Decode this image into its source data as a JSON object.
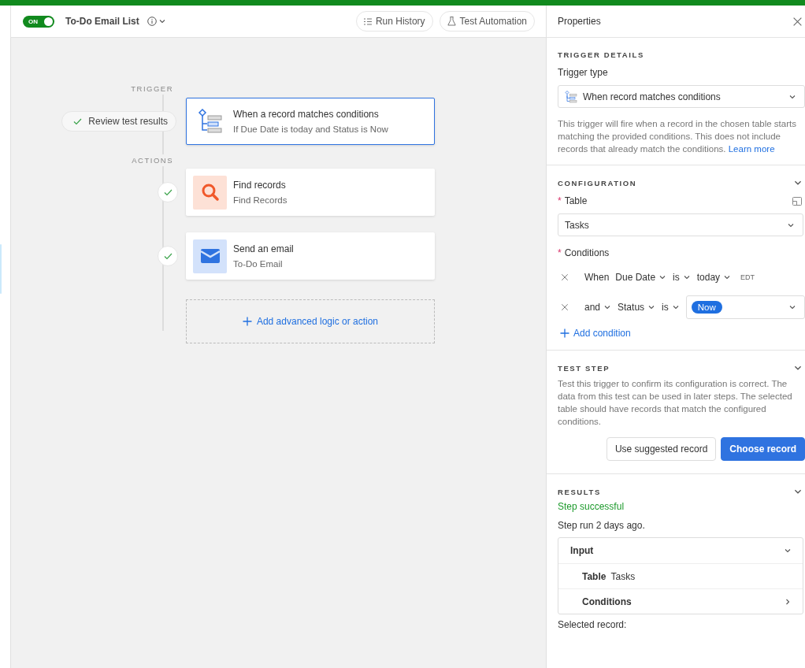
{
  "header": {
    "toggle": {
      "label": "ON",
      "on": true
    },
    "title": "To-Do Email List",
    "buttons": [
      {
        "label": "Run History",
        "kind": "history"
      },
      {
        "label": "Test Automation",
        "kind": "test"
      }
    ]
  },
  "canvas": {
    "trigger_label": "TRIGGER",
    "review_badge": "Review test results",
    "actions_label": "ACTIONS",
    "trigger": {
      "title": "When a record matches conditions",
      "subtitle": "If Due Date is today and Status is Now",
      "selected": true
    },
    "actions": [
      {
        "kind": "find",
        "title": "Find records",
        "subtitle": "Find Records",
        "done": true,
        "selected": false
      },
      {
        "kind": "email",
        "title": "Send an email",
        "subtitle": "To-Do Email",
        "done": true,
        "selected": false
      }
    ],
    "add_button": "Add advanced logic or action"
  },
  "properties": {
    "title": "Properties",
    "trigger_details": {
      "heading": "TRIGGER DETAILS",
      "type_label": "Trigger type",
      "type_value": "When record matches conditions",
      "description": "This trigger will fire when a record in the chosen table starts matching the provided conditions. This does not include records that already match the conditions.",
      "link": "Learn more"
    },
    "configuration": {
      "heading": "CONFIGURATION",
      "table_mark": "*",
      "table_label": "Table",
      "table_value": "Tasks",
      "conditions_mark": "*",
      "conditions_label": "Conditions",
      "conditions": [
        {
          "tokens": [
            {
              "kind": "plain",
              "text": "When"
            },
            {
              "kind": "dropdown",
              "text": "Due Date"
            },
            {
              "kind": "dropdown",
              "text": "is"
            },
            {
              "kind": "dropdown",
              "text": "today"
            },
            {
              "kind": "note",
              "text": "EDT"
            }
          ]
        },
        {
          "tokens": [
            {
              "kind": "dropdown",
              "text": "and"
            },
            {
              "kind": "dropdown",
              "text": "Status"
            },
            {
              "kind": "dropdown",
              "text": "is"
            },
            {
              "kind": "chip-select",
              "text": "Now"
            }
          ]
        }
      ],
      "add_condition": "Add condition"
    },
    "test_step": {
      "heading": "TEST STEP",
      "description": "Test this trigger to confirm its configuration is correct. The data from this test can be used in later steps. The selected table should have records that match the configured conditions.",
      "buttons": [
        {
          "label": "Use suggested record",
          "kind": "secondary"
        },
        {
          "label": "Choose record",
          "kind": "primary"
        }
      ]
    },
    "results": {
      "heading": "RESULTS",
      "status": "Step successful",
      "run_time": "Step run 2 days ago.",
      "input": {
        "title": "Input",
        "expanded": true,
        "rows": [
          {
            "label": "Table",
            "value": "Tasks",
            "expandable": false
          },
          {
            "label": "Conditions",
            "expandable": true
          }
        ]
      },
      "selected_record": "Selected record:"
    }
  }
}
